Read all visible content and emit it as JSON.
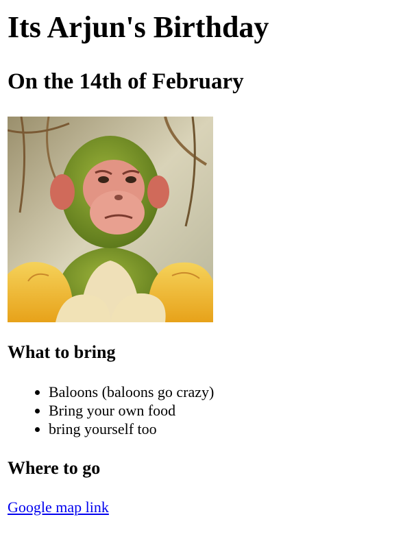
{
  "page": {
    "title": "Its Arjun's Birthday",
    "subtitle": "On the 14th of February"
  },
  "image": {
    "subject": "green-furred monkey with a peeled banana"
  },
  "bring_section": {
    "heading": "What to bring",
    "items": [
      "Baloons (baloons go crazy)",
      "Bring your own food",
      "bring yourself too"
    ]
  },
  "where_section": {
    "heading": "Where to go",
    "link_label": "Google map link"
  },
  "colors": {
    "link": "#0000ee",
    "text": "#000000",
    "background": "#ffffff"
  }
}
